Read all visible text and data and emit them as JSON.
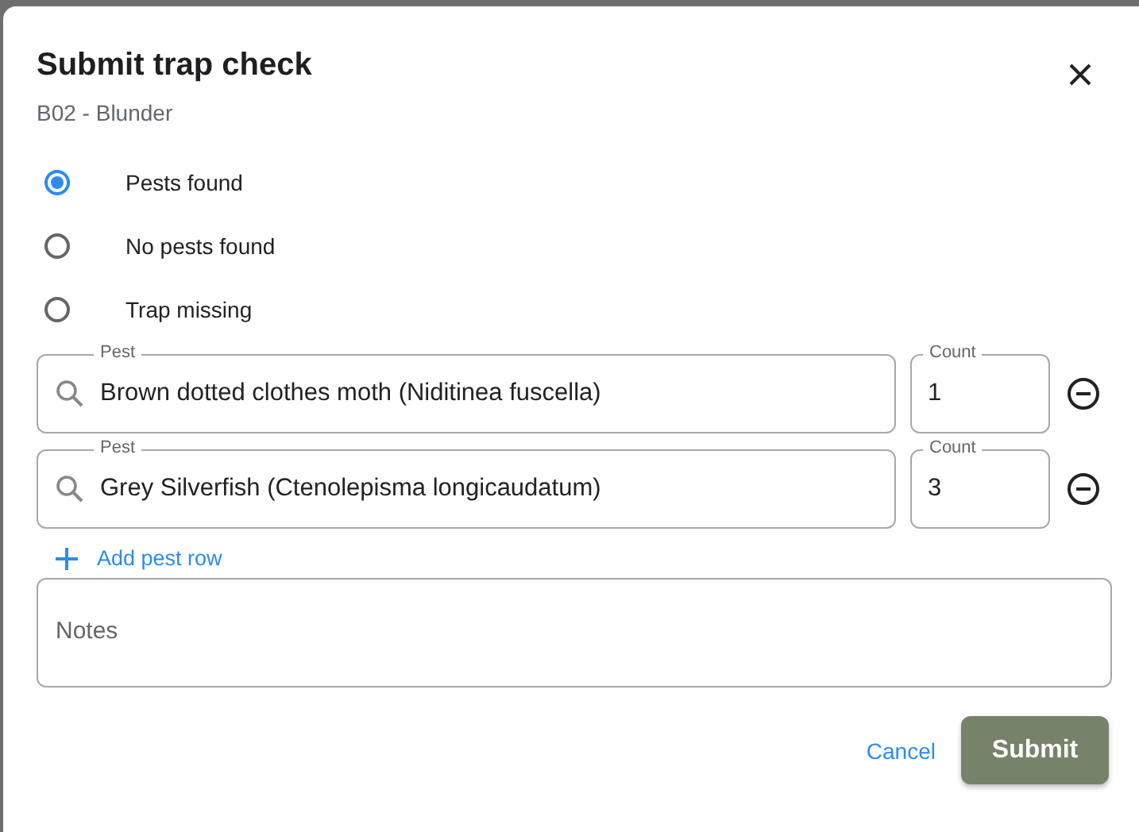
{
  "dialog": {
    "title": "Submit trap check",
    "subtitle": "B02 - Blunder"
  },
  "options": [
    {
      "label": "Pests found",
      "selected": true
    },
    {
      "label": "No pests found",
      "selected": false
    },
    {
      "label": "Trap missing",
      "selected": false
    }
  ],
  "pest_rows": [
    {
      "pest_label": "Pest",
      "pest": "Brown dotted clothes moth (Niditinea fuscella)",
      "count_label": "Count",
      "count": "1"
    },
    {
      "pest_label": "Pest",
      "pest": "Grey Silverfish (Ctenolepisma longicaudatum)",
      "count_label": "Count",
      "count": "3"
    }
  ],
  "add_row": "Add pest row",
  "notes": {
    "placeholder": "Notes"
  },
  "buttons": {
    "cancel": "Cancel",
    "submit": "Submit"
  }
}
